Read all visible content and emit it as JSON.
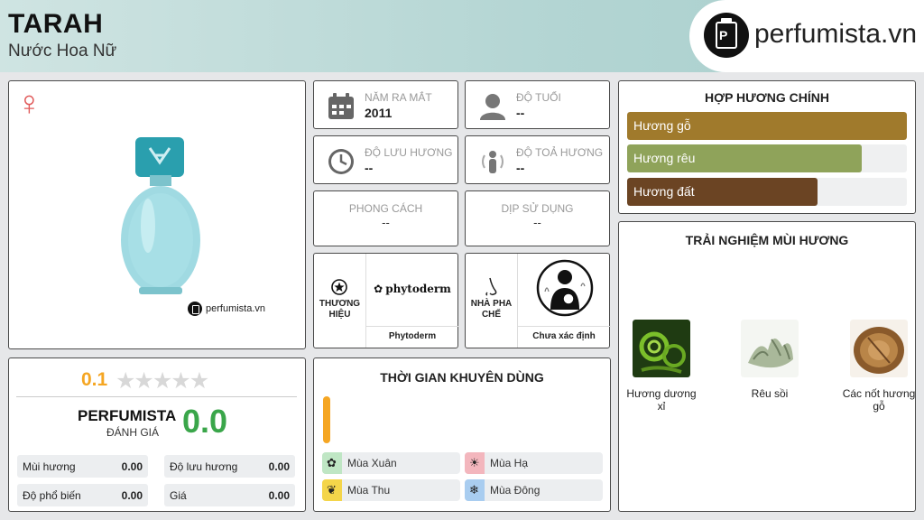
{
  "header": {
    "title": "TARAH",
    "subtitle": "Nước Hoa Nữ",
    "brand": "perfumista.vn"
  },
  "product": {
    "gender_symbol": "♀",
    "watermark": "perfumista.vn"
  },
  "info": {
    "release": {
      "label": "NĂM RA MẮT",
      "value": "2011",
      "icon": "calendar-icon"
    },
    "age": {
      "label": "ĐỘ TUỔI",
      "value": "--",
      "icon": "person-icon"
    },
    "longevity": {
      "label": "ĐỘ LƯU HƯƠNG",
      "value": "--",
      "icon": "clock-icon"
    },
    "sillage": {
      "label": "ĐỘ TOẢ HƯƠNG",
      "value": "--",
      "icon": "radiating-person-icon"
    },
    "style": {
      "label": "PHONG CÁCH",
      "value": "--"
    },
    "occasion": {
      "label": "DỊP SỬ DỤNG",
      "value": "--"
    },
    "brand": {
      "side_label": "THƯƠNG HIỆU",
      "logo_text": "phytoderm",
      "name": "Phytoderm",
      "icon": "star-badge-icon"
    },
    "perfumer": {
      "side_label": "NHÀ PHA CHẾ",
      "name": "Chưa xác định",
      "icon": "nose-icon"
    }
  },
  "accords": {
    "title": "HỢP HƯƠNG CHÍNH",
    "items": [
      {
        "label": "Hương gỗ",
        "value": 1.0,
        "color": "#a07a2c"
      },
      {
        "label": "Hương rêu",
        "value": 0.84,
        "color": "#8fa35a"
      },
      {
        "label": "Hương đất",
        "value": 0.68,
        "color": "#6b4423"
      }
    ]
  },
  "experience": {
    "title": "TRẢI NGHIỆM MÙI HƯƠNG",
    "notes": [
      {
        "name": "Hương dương xỉ"
      },
      {
        "name": "Rêu sồi"
      },
      {
        "name": "Các nốt hương gỗ"
      }
    ]
  },
  "rating": {
    "score": "0.1",
    "stars": 0,
    "perfumista_label": "PERFUMISTA",
    "perfumista_sub": "ĐÁNH GIÁ",
    "perfumista_score": "0.0",
    "stats": [
      {
        "label": "Mùi hương",
        "value": "0.00"
      },
      {
        "label": "Độ lưu hương",
        "value": "0.00"
      },
      {
        "label": "Độ phổ biến",
        "value": "0.00"
      },
      {
        "label": "Giá",
        "value": "0.00"
      }
    ]
  },
  "time": {
    "title": "THỜI GIAN KHUYÊN DÙNG",
    "seasons": [
      {
        "label": "Mùa Xuân",
        "color": "#bfe6c4",
        "icon": "flower-icon"
      },
      {
        "label": "Mùa Hạ",
        "color": "#f3b6bd",
        "icon": "sun-icon"
      },
      {
        "label": "Mùa Thu",
        "color": "#f4d54a",
        "icon": "leaf-icon"
      },
      {
        "label": "Mùa Đông",
        "color": "#a9cdf0",
        "icon": "snowflake-icon"
      }
    ]
  }
}
